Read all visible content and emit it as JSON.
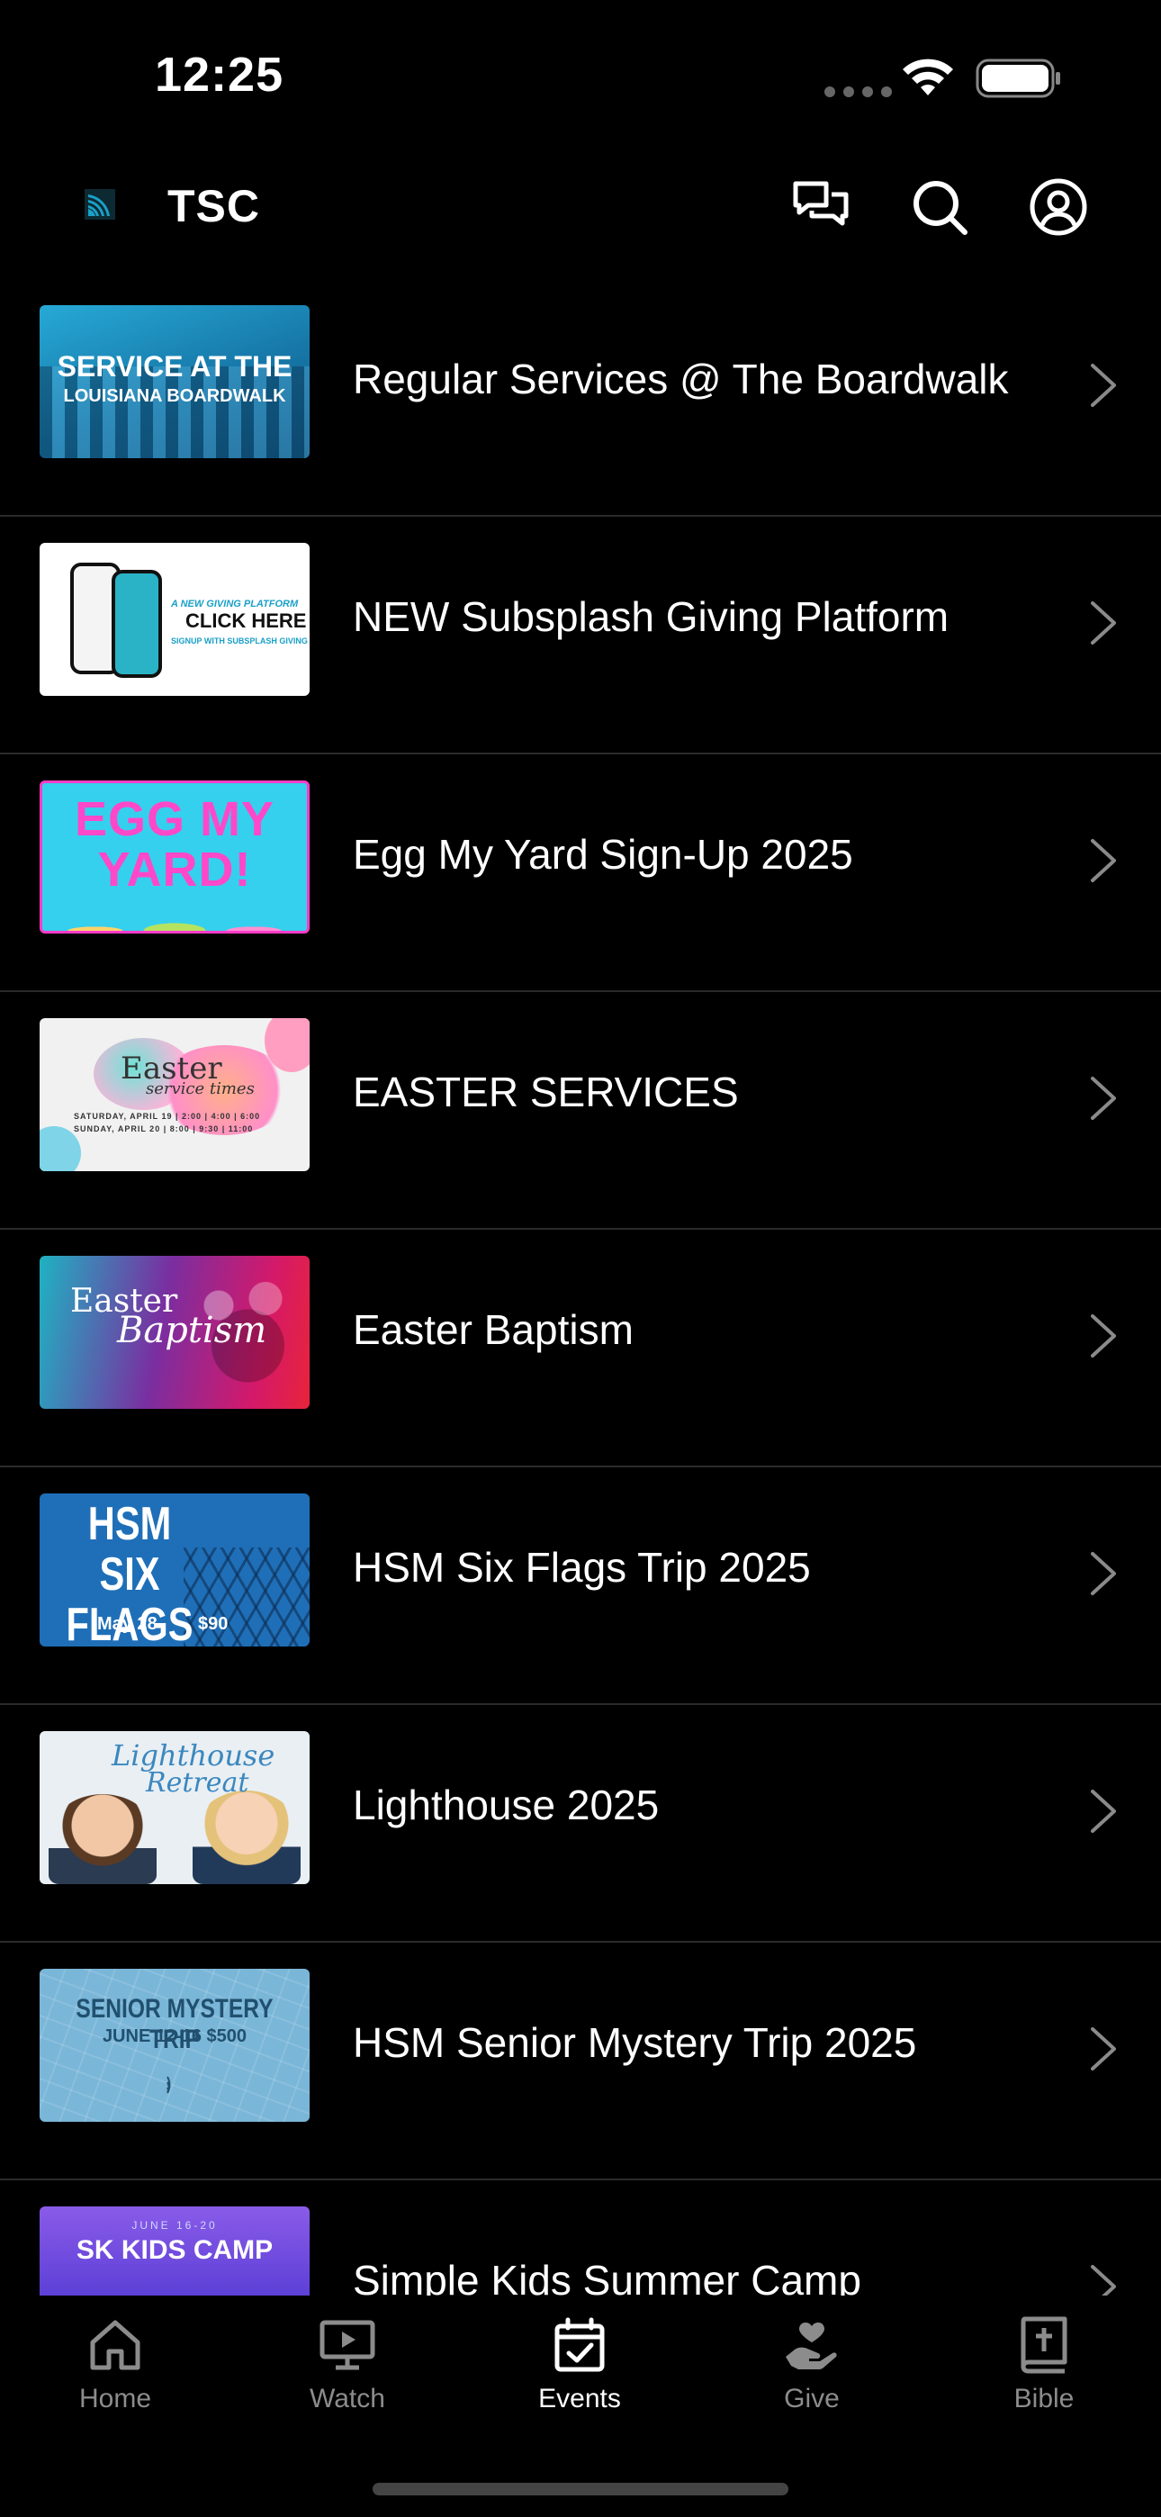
{
  "status_bar": {
    "time": "12:25"
  },
  "header": {
    "title": "TSC",
    "icons": [
      "chat-icon",
      "search-icon",
      "profile-icon"
    ],
    "accent_color": "#1aa0c8"
  },
  "events": [
    {
      "title": "Regular Services @ The Boardwalk",
      "thumb": {
        "line1": "SERVICE AT THE",
        "line2": "LOUISIANA BOARDWALK"
      }
    },
    {
      "title": "NEW Subsplash Giving Platform",
      "thumb": {
        "line1": "A NEW GIVING PLATFORM",
        "line2": "CLICK HERE",
        "line3": "SIGNUP WITH SUBSPLASH GIVING"
      }
    },
    {
      "title": "Egg My Yard Sign-Up 2025",
      "thumb": {
        "line1": "EGG MY YARD!"
      }
    },
    {
      "title": "EASTER SERVICES",
      "thumb": {
        "line1": "Easter",
        "line2": "service times",
        "line3": "SATURDAY, APRIL 19 | 2:00 | 4:00 | 6:00",
        "line4": "SUNDAY, APRIL 20 | 8:00 | 9:30 | 11:00"
      }
    },
    {
      "title": "Easter Baptism",
      "thumb": {
        "line1": "Easter",
        "line2": "Baptism"
      }
    },
    {
      "title": "HSM Six Flags Trip 2025",
      "thumb": {
        "line1": "HSM SIX FLAGS",
        "line2": "May 28",
        "line3": "$90"
      }
    },
    {
      "title": "Lighthouse 2025",
      "thumb": {
        "line1": "Lighthouse",
        "line2": "Retreat"
      }
    },
    {
      "title": "HSM Senior Mystery Trip 2025",
      "thumb": {
        "line1": "SENIOR MYSTERY TRIP",
        "line2": "JUNE 12-16 $500"
      }
    },
    {
      "title": "Simple Kids Summer Camp",
      "thumb": {
        "line0": "JUNE 16-20",
        "line1": "SK KIDS CAMP"
      }
    }
  ],
  "tab_bar": {
    "tabs": [
      {
        "label": "Home",
        "icon": "home-icon",
        "active": false
      },
      {
        "label": "Watch",
        "icon": "watch-icon",
        "active": false
      },
      {
        "label": "Events",
        "icon": "events-icon",
        "active": true
      },
      {
        "label": "Give",
        "icon": "give-icon",
        "active": false
      },
      {
        "label": "Bible",
        "icon": "bible-icon",
        "active": false
      }
    ]
  }
}
